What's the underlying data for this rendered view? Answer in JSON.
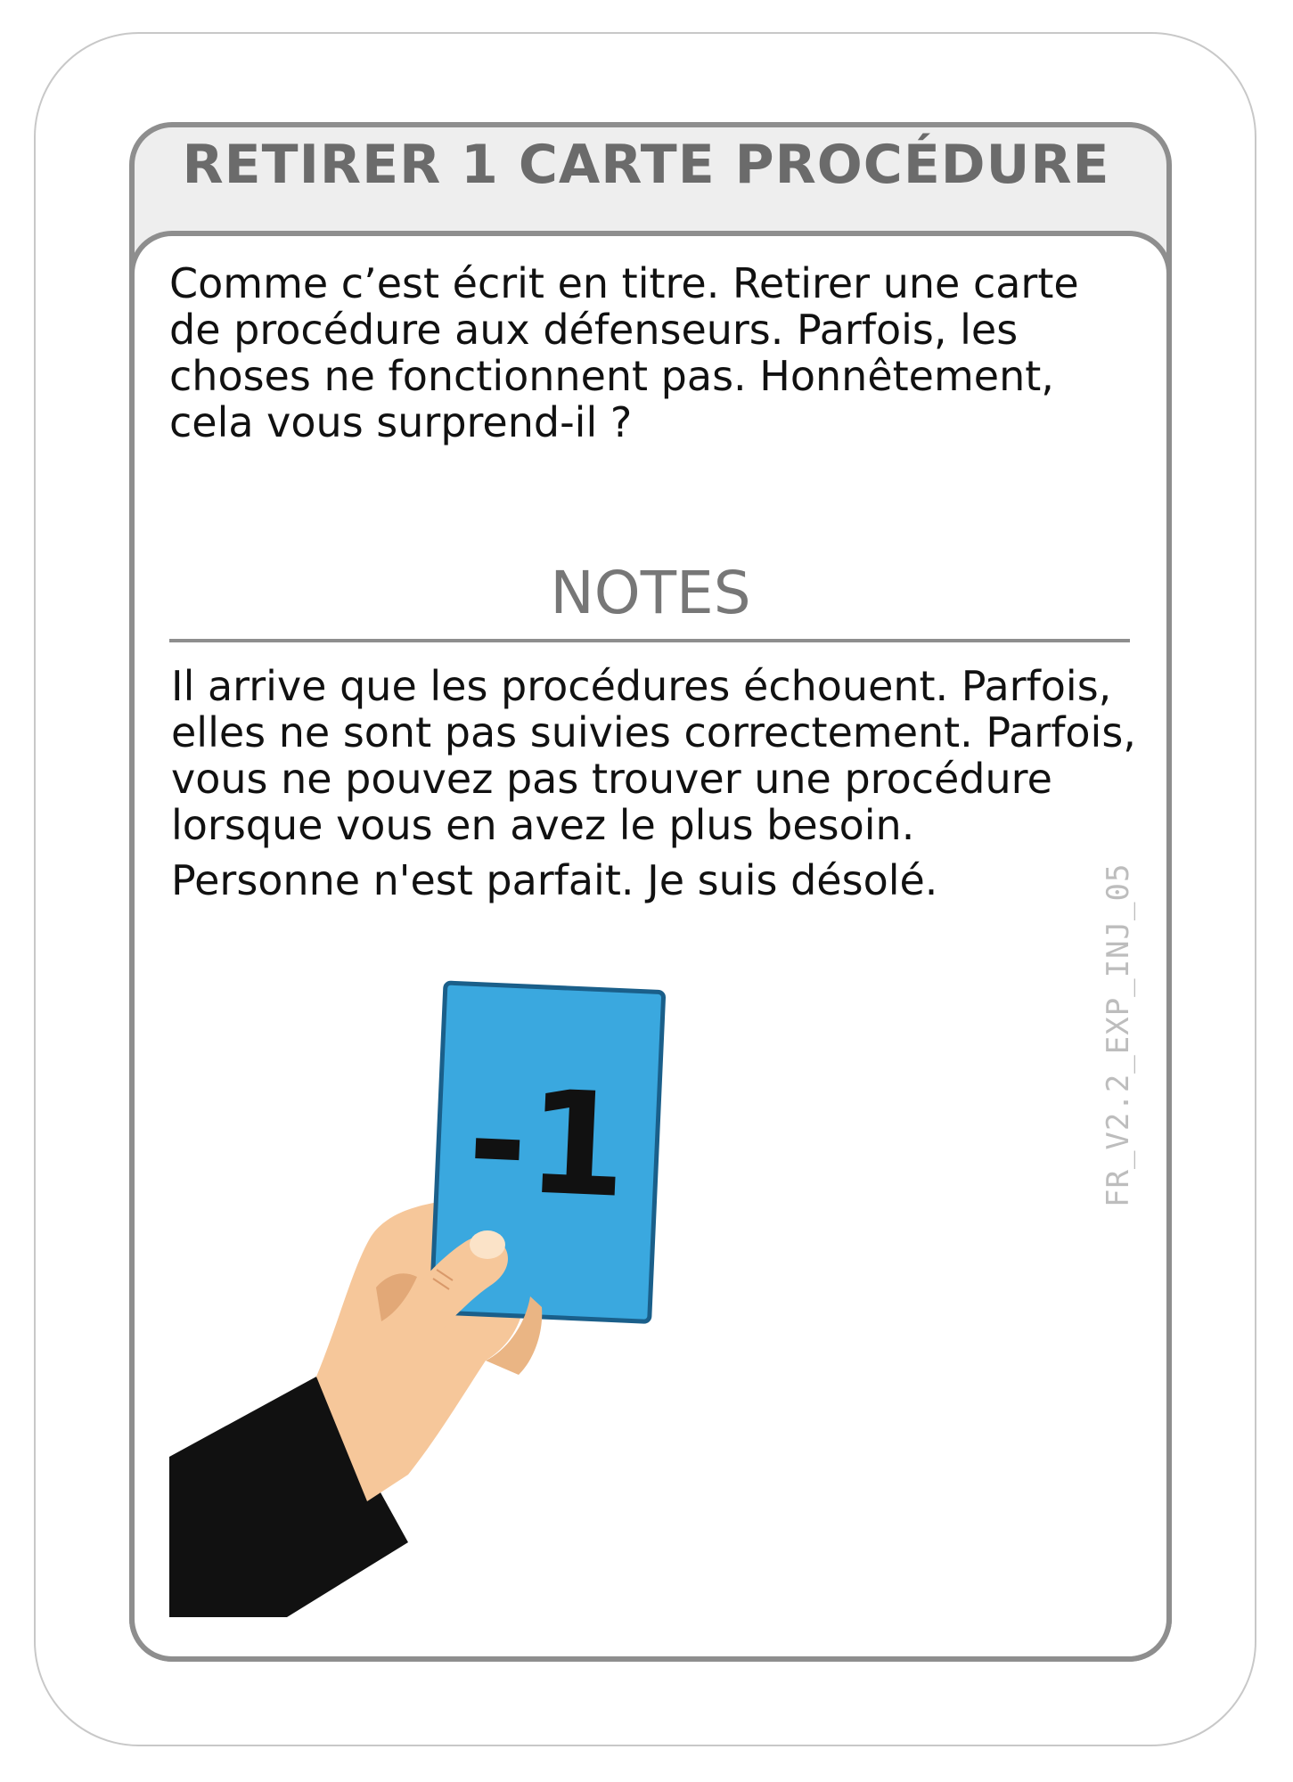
{
  "card": {
    "title": "RETIRER 1 CARTE PROCÉDURE",
    "description": "Comme c’est écrit en titre. Retirer une carte de procédure aux défenseurs. Parfois, les choses ne fonctionnent pas. Honnêtement, cela vous surprend-il ?",
    "notes_heading": "NOTES",
    "notes_paragraphs": [
      "Il arrive que les procédures échouent. Parfois, elles ne sont pas suivies correctement. Parfois, vous ne pouvez pas trouver une procédure lorsque vous en avez le plus besoin.",
      "Personne n'est parfait. Je suis désolé."
    ],
    "card_code": "FR_V2.2_EXP_INJ_05",
    "illustration": {
      "held_card_label": "-1",
      "held_card_color": "#3aa8df",
      "skin_color": "#f6c79a",
      "sleeve_color": "#111111"
    }
  }
}
